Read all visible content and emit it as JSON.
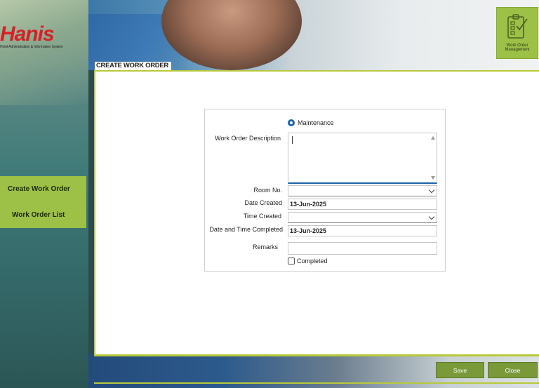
{
  "logo": {
    "word": "Hanis",
    "subtitle": "Hotel Administration & Information System"
  },
  "module": {
    "label": "Work Order Management",
    "icon": "clipboard-check-icon"
  },
  "sidebar": {
    "items": [
      {
        "label": "Create Work Order"
      },
      {
        "label": "Work Order List"
      }
    ]
  },
  "page": {
    "title": "CREATE WORK ORDER"
  },
  "form": {
    "type_option": "Maintenance",
    "description_label": "Work Order Description",
    "description_value": "",
    "room_label": "Room No.",
    "room_value": "",
    "date_created_label": "Date Created",
    "date_created_value": "13-Jun-2025",
    "time_created_label": "Time Created",
    "time_created_value": "",
    "completed_dt_label": "Date and Time Completed",
    "completed_dt_value": "13-Jun-2025",
    "remarks_label": "Remarks",
    "remarks_value": "",
    "completed_checkbox": "Completed"
  },
  "actions": {
    "save": "Save",
    "close": "Close"
  },
  "colors": {
    "accent_green": "#9dc046",
    "button_green": "#7a9a3a",
    "line_green": "#b8c93b",
    "focus_blue": "#1d62a8",
    "logo_red": "#d81f26"
  }
}
